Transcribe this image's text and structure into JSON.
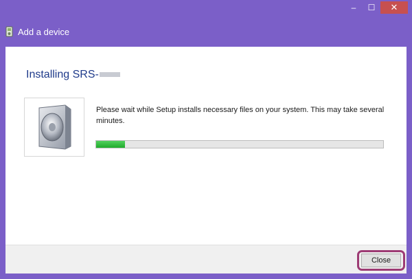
{
  "window": {
    "title": "Add a device",
    "caption_buttons": {
      "minimize": "–",
      "maximize": "☐",
      "close": "✕"
    }
  },
  "content": {
    "heading": "Installing SRS-",
    "message": "Please wait while Setup installs necessary files on your system. This may take several minutes.",
    "progress_fraction": 0.1,
    "progress_color": "#2fbf3a",
    "device_icon": "speaker-icon"
  },
  "footer": {
    "close_label": "Close"
  },
  "colors": {
    "frame": "#7b5fc8",
    "heading": "#1e3a8a",
    "highlight": "#9d3b74"
  }
}
